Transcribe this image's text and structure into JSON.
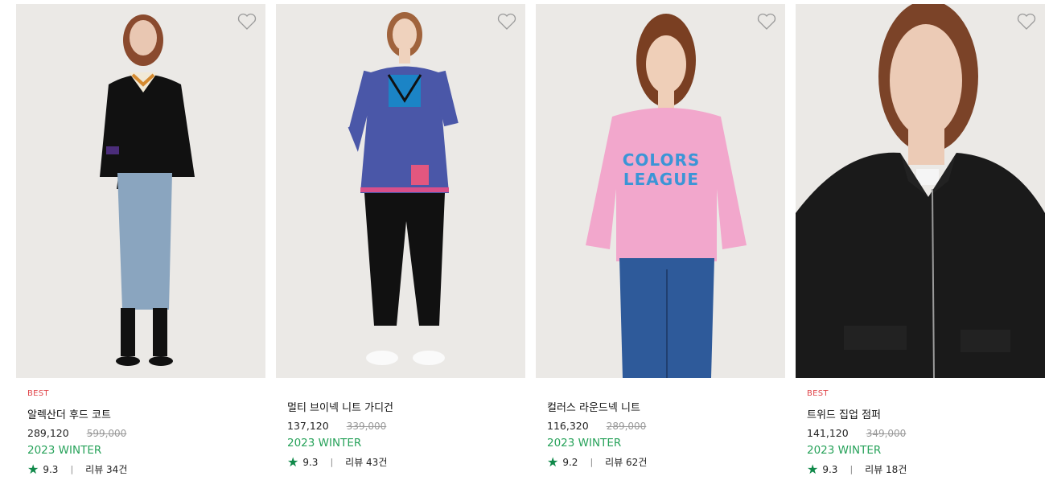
{
  "products": [
    {
      "badge": "BEST",
      "name": "알렉산더 후드 코트",
      "price": "289,120",
      "orig_price": "599,000",
      "season": "2023 WINTER",
      "score": "9.3",
      "reviews": "리뷰 34건",
      "icon": "heart-outline-icon"
    },
    {
      "badge": "",
      "name": "멀티 브이넥 니트 가디건",
      "price": "137,120",
      "orig_price": "339,000",
      "season": "2023 WINTER",
      "score": "9.3",
      "reviews": "리뷰 43건",
      "icon": "heart-outline-icon"
    },
    {
      "badge": "",
      "name": "컬러스 라운드넥 니트",
      "price": "116,320",
      "orig_price": "289,000",
      "season": "2023 WINTER",
      "score": "9.2",
      "reviews": "리뷰 62건",
      "icon": "heart-outline-icon",
      "print_text": "COLORS LEAGUE"
    },
    {
      "badge": "BEST",
      "name": "트위드 집업 점퍼",
      "price": "141,120",
      "orig_price": "349,000",
      "season": "2023 WINTER",
      "score": "9.3",
      "reviews": "리뷰 18건",
      "icon": "heart-outline-icon"
    }
  ],
  "colors": {
    "badge": "#e0454a",
    "season": "#27a25a",
    "star": "#10894a",
    "strike": "#9a9a9a"
  },
  "separator": "|",
  "star_icon": "star-icon"
}
